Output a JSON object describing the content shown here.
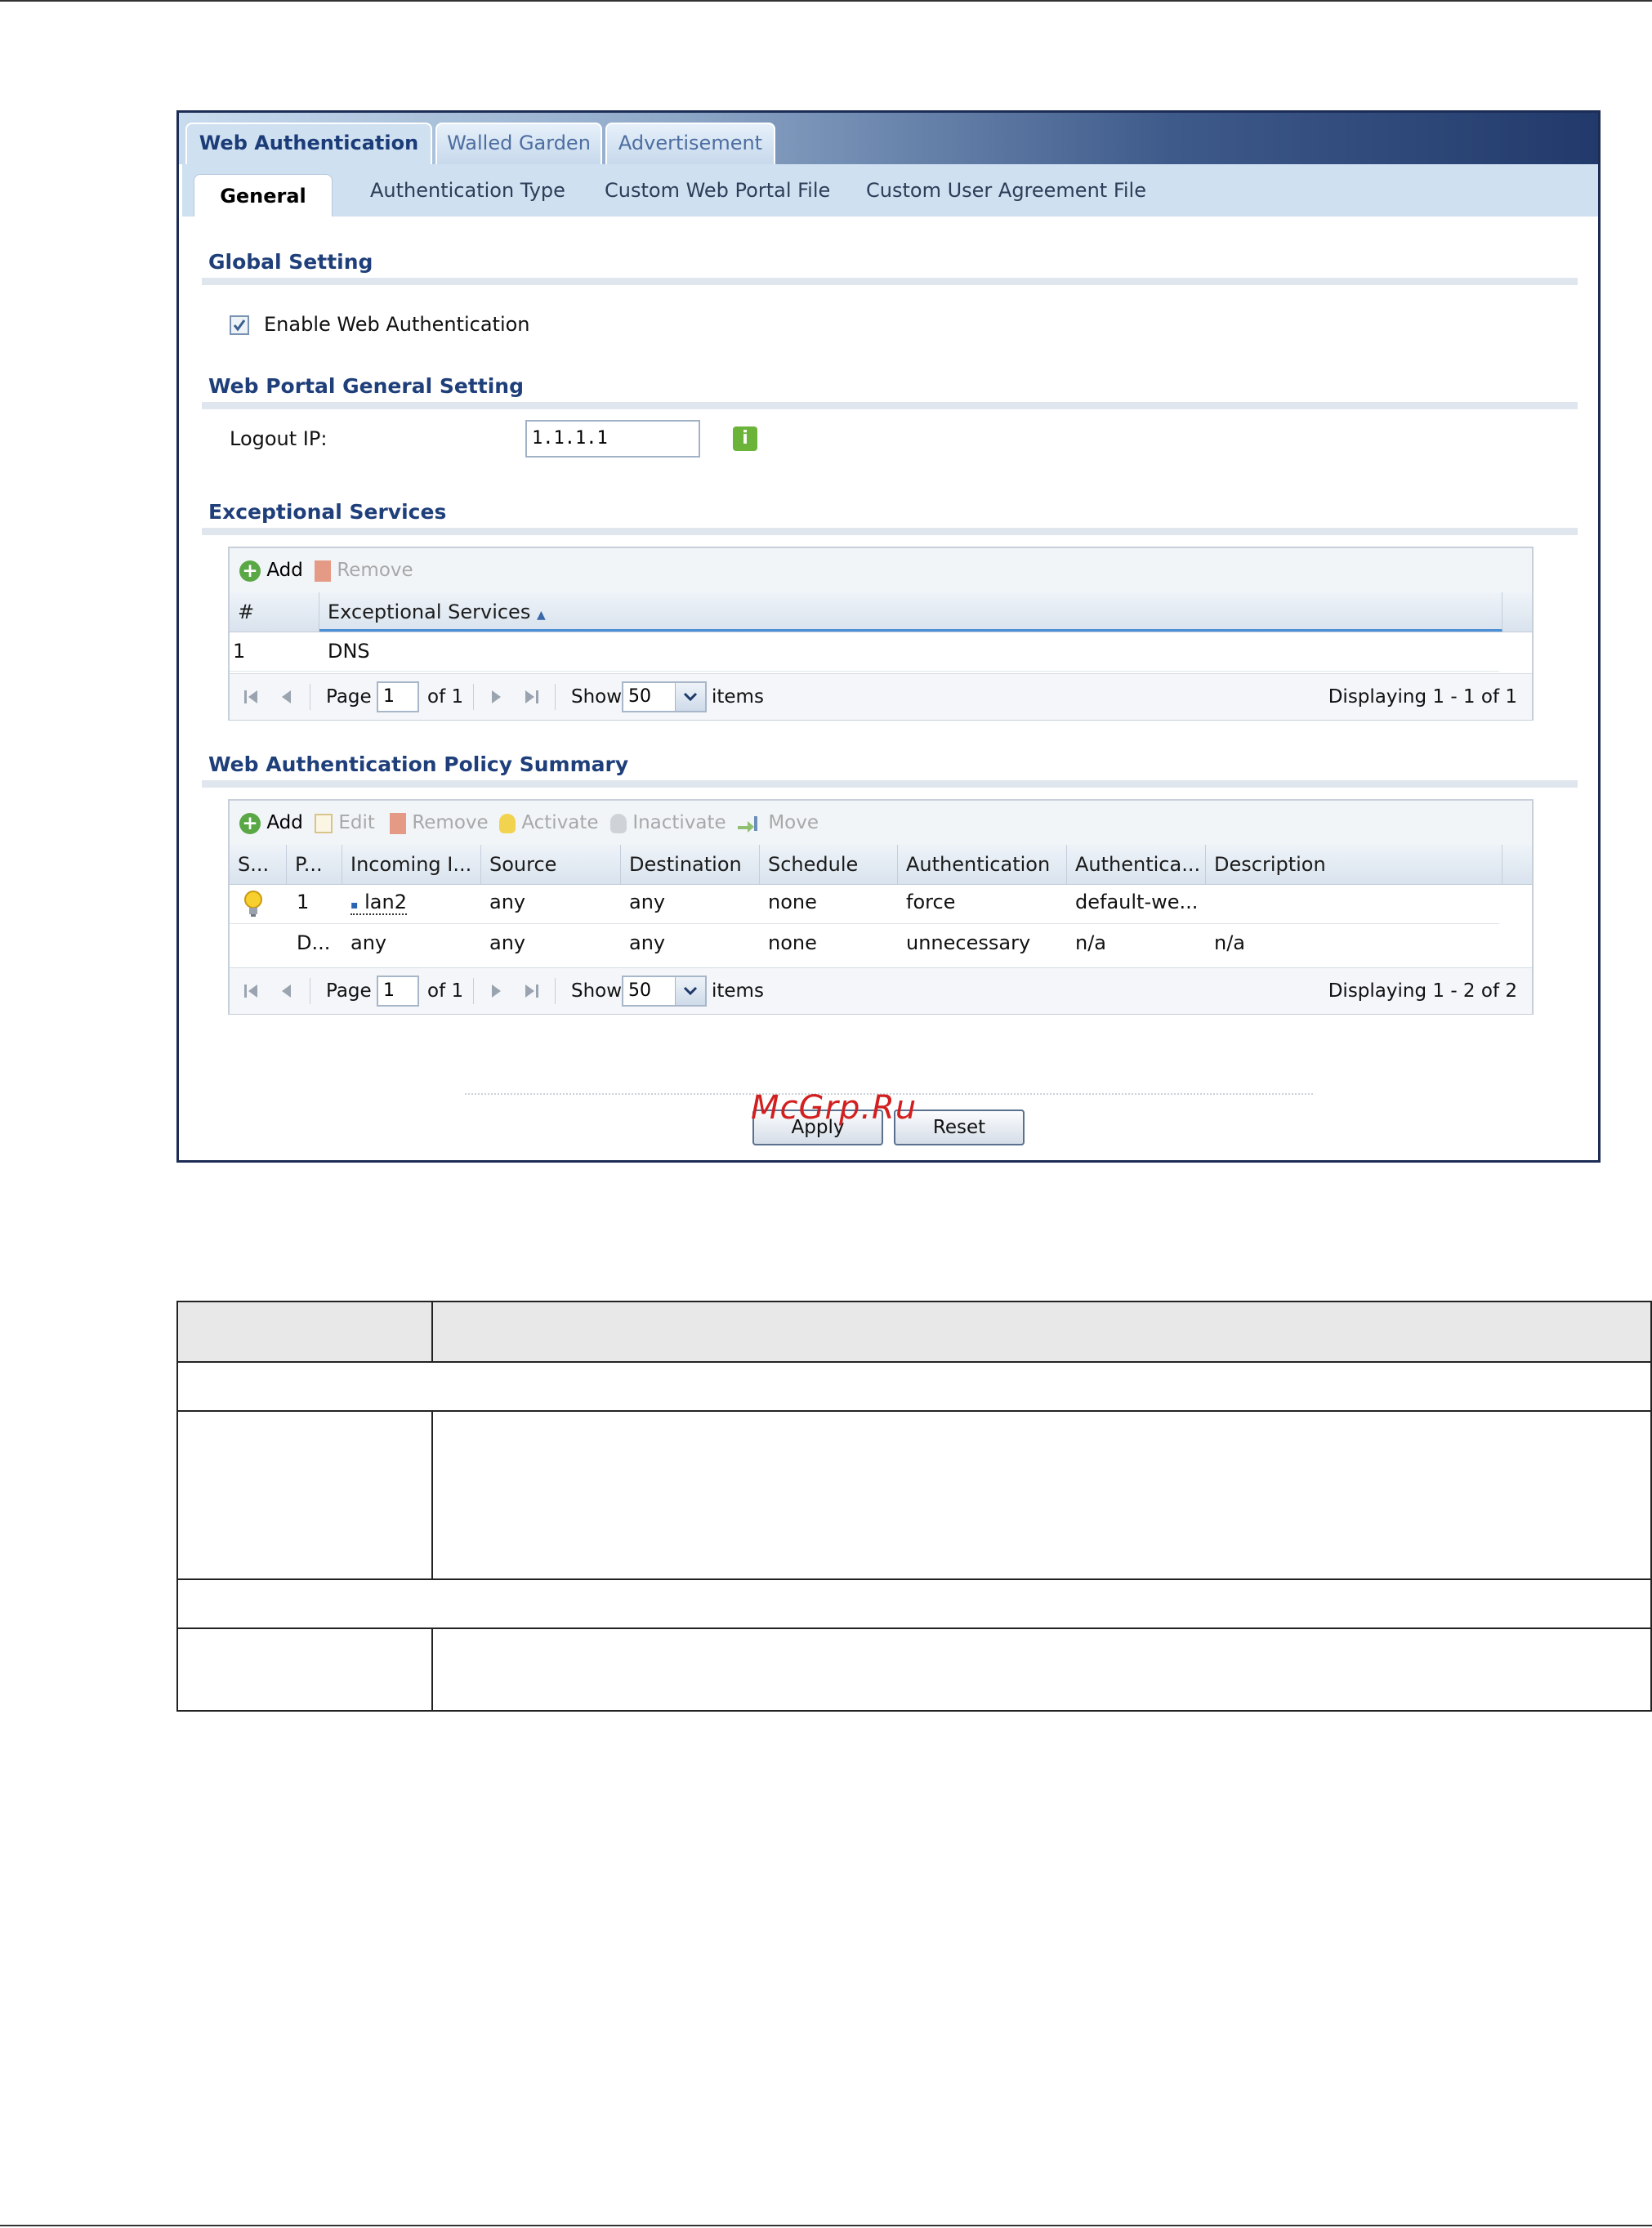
{
  "tabs": [
    "Web Authentication",
    "Walled Garden",
    "Advertisement"
  ],
  "subtabs": [
    "General",
    "Authentication Type",
    "Custom Web Portal File",
    "Custom User Agreement File"
  ],
  "global": {
    "title": "Global Setting",
    "enable_label": "Enable Web Authentication",
    "enable_checked": true
  },
  "portal": {
    "title": "Web Portal General Setting",
    "logout_label": "Logout IP:",
    "logout_value": "1.1.1.1"
  },
  "exceptional": {
    "title": "Exceptional Services",
    "toolbar": {
      "add": "Add",
      "remove": "Remove"
    },
    "columns": [
      "#",
      "Exceptional Services"
    ],
    "rows": [
      {
        "num": "1",
        "service": "DNS"
      }
    ],
    "pager": {
      "page_label": "Page",
      "page": "1",
      "of": "of 1",
      "show": "Show",
      "items_per_page": "50",
      "items": "items",
      "displaying": "Displaying 1 - 1 of 1"
    }
  },
  "policy": {
    "title": "Web Authentication Policy Summary",
    "toolbar": {
      "add": "Add",
      "edit": "Edit",
      "remove": "Remove",
      "activate": "Activate",
      "inactivate": "Inactivate",
      "move": "Move"
    },
    "columns": [
      "S...",
      "P...",
      "Incoming I...",
      "Source",
      "Destination",
      "Schedule",
      "Authentication",
      "Authentica...",
      "Description"
    ],
    "rows": [
      {
        "priority": "1",
        "incoming": "lan2",
        "source": "any",
        "destination": "any",
        "schedule": "none",
        "authentication": "force",
        "auth_type": "default-we...",
        "description": ""
      },
      {
        "priority": "D...",
        "incoming": "any",
        "source": "any",
        "destination": "any",
        "schedule": "none",
        "authentication": "unnecessary",
        "auth_type": "n/a",
        "description": "n/a"
      }
    ],
    "pager": {
      "page_label": "Page",
      "page": "1",
      "of": "of 1",
      "show": "Show",
      "items_per_page": "50",
      "items": "items",
      "displaying": "Displaying 1 - 2 of 2"
    }
  },
  "buttons": {
    "apply": "Apply",
    "reset": "Reset"
  },
  "watermark": "McGrp.Ru"
}
